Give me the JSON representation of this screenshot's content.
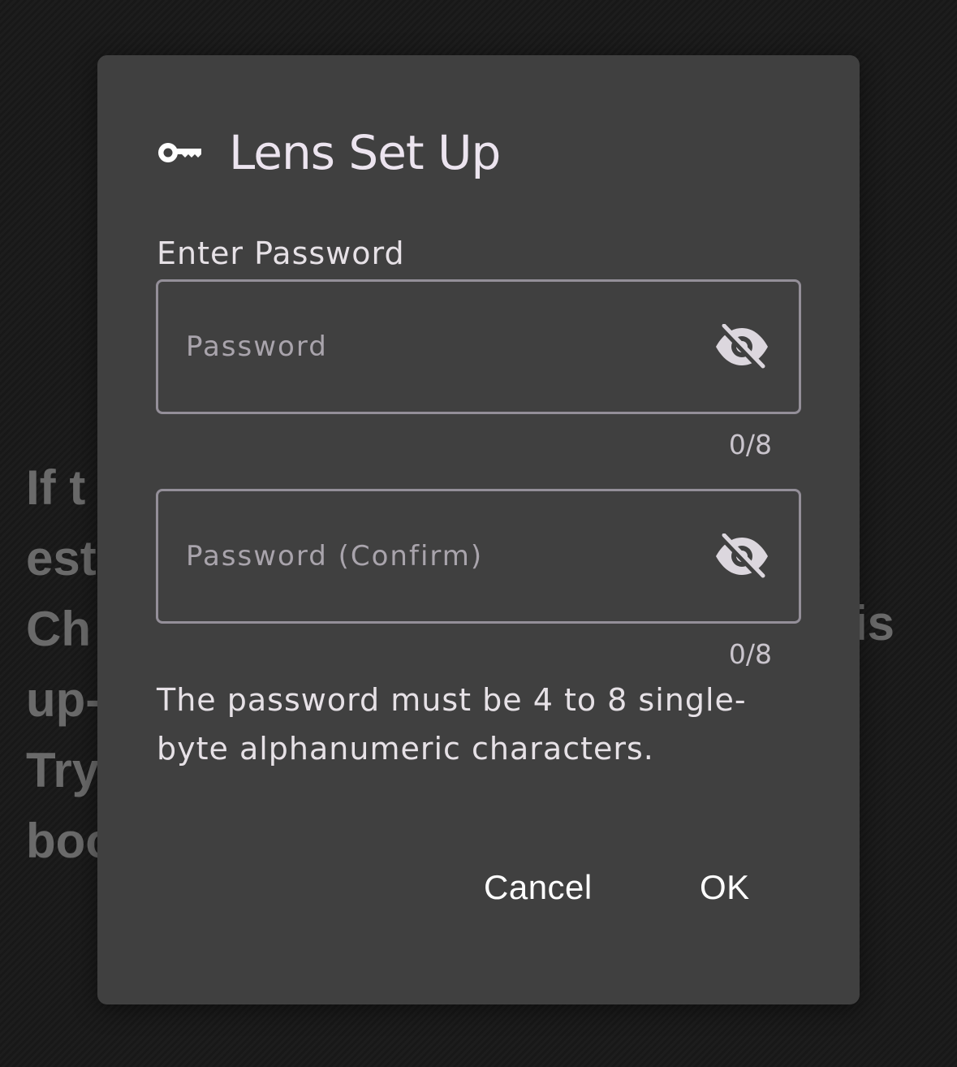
{
  "background": {
    "lines": [
      "If t",
      "est",
      "Ch",
      "up-",
      "Try",
      "boo"
    ],
    "right_fragment": "is"
  },
  "dialog": {
    "icon": "key-icon",
    "title": "Lens Set Up",
    "field_label": "Enter Password",
    "password": {
      "value": "",
      "placeholder": "Password",
      "counter": "0/8",
      "visibility_icon": "eye-off-icon"
    },
    "password_confirm": {
      "value": "",
      "placeholder": "Password (Confirm)",
      "counter": "0/8",
      "visibility_icon": "eye-off-icon"
    },
    "helper_text_lines": [
      "The password must be 4 to 8 single-",
      "byte alphanumeric characters."
    ],
    "buttons": {
      "cancel": "Cancel",
      "ok": "OK"
    }
  }
}
